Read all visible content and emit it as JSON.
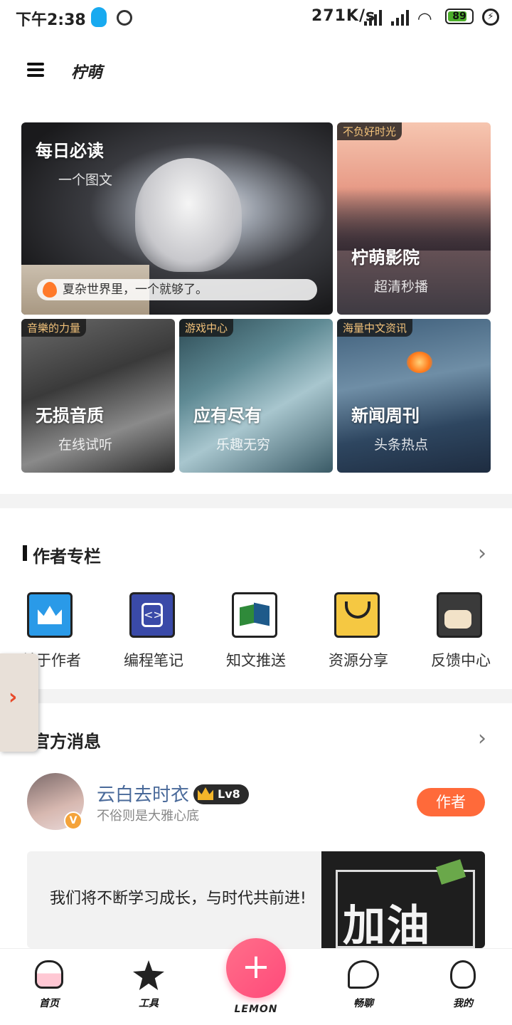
{
  "status": {
    "time": "下午2:38",
    "speed": "271K/s",
    "battery": "89",
    "charge_icon": "⚡"
  },
  "app": {
    "title": "柠萌"
  },
  "featured": {
    "main": {
      "title": "每日必读",
      "subtitle": "一个图文",
      "quote": "夏杂世界里，一个就够了。"
    },
    "movie": {
      "tag": "不负好时光",
      "title": "柠萌影院",
      "subtitle": "超清秒播"
    },
    "music": {
      "tag": "音樂的力量",
      "title": "无损音质",
      "subtitle": "在线试听"
    },
    "games": {
      "tag": "游戏中心",
      "title": "应有尽有",
      "subtitle": "乐趣无穷"
    },
    "news": {
      "tag": "海量中文资讯",
      "title": "新闻周刊",
      "subtitle": "头条热点"
    }
  },
  "author_column": {
    "title": "作者专栏",
    "items": [
      {
        "label": "关于作者",
        "icon": "crown-icon"
      },
      {
        "label": "编程笔记",
        "icon": "code-icon"
      },
      {
        "label": "知文推送",
        "icon": "book-icon"
      },
      {
        "label": "资源分享",
        "icon": "bag-icon"
      },
      {
        "label": "反馈中心",
        "icon": "chat-icon"
      }
    ]
  },
  "official": {
    "title": "官方消息",
    "user": {
      "name": "云白去时衣",
      "level": "Lv8",
      "motto": "不俗则是大雅心底",
      "badge": "V",
      "button": "作者"
    },
    "message": "我们将不断学习成长，与时代共前进!",
    "image_text": "加油"
  },
  "nav": {
    "home": "首页",
    "tools": "工具",
    "center": "LEMON",
    "center_symbol": "+",
    "chat": "畅聊",
    "mine": "我的"
  },
  "colors": {
    "accent": "#ff4a7a",
    "author_button": "#ff6a3a",
    "tag_text": "#f2c27a"
  }
}
